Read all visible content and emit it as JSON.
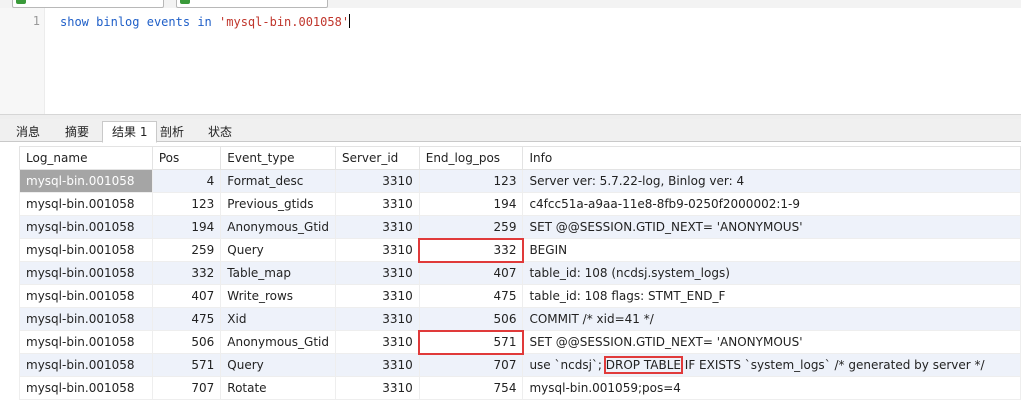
{
  "editor": {
    "line_number": "1",
    "code": {
      "kw1": "show",
      "kw2": "binlog",
      "kw3": "events",
      "kw4": "in",
      "str": "'mysql-bin.001058'"
    }
  },
  "tabs": [
    "消息",
    "摘要",
    "结果 1",
    "剖析",
    "状态"
  ],
  "active_tab": "结果 1",
  "table": {
    "columns": [
      "Log_name",
      "Pos",
      "Event_type",
      "Server_id",
      "End_log_pos",
      "Info"
    ],
    "rows": [
      [
        "mysql-bin.001058",
        "4",
        "Format_desc",
        "3310",
        "123",
        "Server ver: 5.7.22-log, Binlog ver: 4"
      ],
      [
        "mysql-bin.001058",
        "123",
        "Previous_gtids",
        "3310",
        "194",
        "c4fcc51a-a9aa-11e8-8fb9-0250f2000002:1-9"
      ],
      [
        "mysql-bin.001058",
        "194",
        "Anonymous_Gtid",
        "3310",
        "259",
        "SET @@SESSION.GTID_NEXT= 'ANONYMOUS'"
      ],
      [
        "mysql-bin.001058",
        "259",
        "Query",
        "3310",
        "332",
        "BEGIN"
      ],
      [
        "mysql-bin.001058",
        "332",
        "Table_map",
        "3310",
        "407",
        "table_id: 108 (ncdsj.system_logs)"
      ],
      [
        "mysql-bin.001058",
        "407",
        "Write_rows",
        "3310",
        "475",
        "table_id: 108 flags: STMT_END_F"
      ],
      [
        "mysql-bin.001058",
        "475",
        "Xid",
        "3310",
        "506",
        "COMMIT /* xid=41 */"
      ],
      [
        "mysql-bin.001058",
        "506",
        "Anonymous_Gtid",
        "3310",
        "571",
        "SET @@SESSION.GTID_NEXT= 'ANONYMOUS'"
      ],
      [
        "mysql-bin.001058",
        "571",
        "Query",
        "3310",
        "707",
        "use `ncdsj`; DROP TABLE IF EXISTS `system_logs` /* generated by server */"
      ],
      [
        "mysql-bin.001058",
        "707",
        "Rotate",
        "3310",
        "754",
        "mysql-bin.001059;pos=4"
      ]
    ],
    "drop_info": {
      "pre": "use `ncdsj`; ",
      "mark": "DROP TABLE",
      "post": " IF EXISTS `system_logs` /* generated by server */"
    }
  },
  "colors": {
    "highlight_box": "#e03a3a",
    "selected_cell": "#a5a5a5",
    "alt_row": "#eef2fa",
    "keyword": "#1f5fc8",
    "string": "#c0362c"
  }
}
